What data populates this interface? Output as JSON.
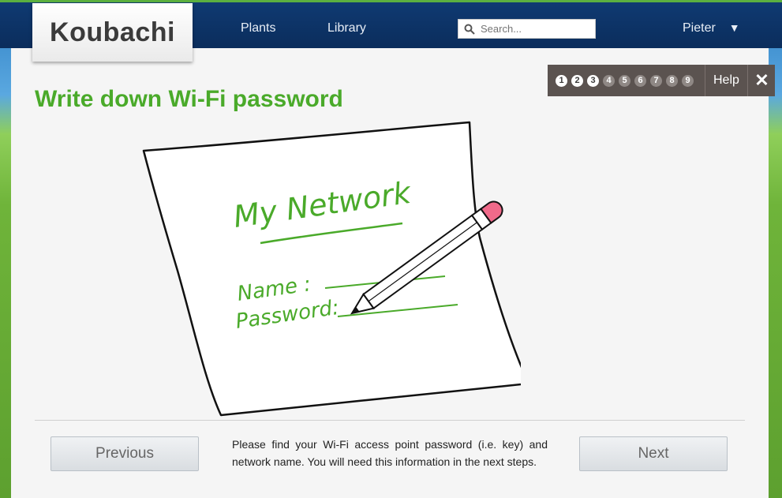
{
  "header": {
    "logo": "Koubachi",
    "nav": [
      {
        "label": "Plants"
      },
      {
        "label": "Library"
      }
    ],
    "search": {
      "placeholder": "Search...",
      "value": ""
    },
    "user": {
      "name": "Pieter",
      "caret": "▼"
    }
  },
  "wizard": {
    "title": "Write down Wi-Fi password",
    "steps": [
      {
        "label": "1",
        "state": "done"
      },
      {
        "label": "2",
        "state": "done"
      },
      {
        "label": "3",
        "state": "current"
      },
      {
        "label": "4",
        "state": "todo"
      },
      {
        "label": "5",
        "state": "todo"
      },
      {
        "label": "6",
        "state": "todo"
      },
      {
        "label": "7",
        "state": "todo"
      },
      {
        "label": "8",
        "state": "todo"
      },
      {
        "label": "9",
        "state": "todo"
      }
    ],
    "help_label": "Help",
    "close_symbol": "✕",
    "illustration": {
      "heading": "My Network",
      "name_label": "Name :",
      "password_label": "Password:"
    },
    "description": "Please find your Wi-Fi access point password (i.e. key) and network name. You will need this information in the next steps.",
    "previous_label": "Previous",
    "next_label": "Next"
  },
  "colors": {
    "accent_green": "#4aaa2a",
    "nav_blue": "#0f3a72",
    "step_bar": "#5b5350"
  }
}
